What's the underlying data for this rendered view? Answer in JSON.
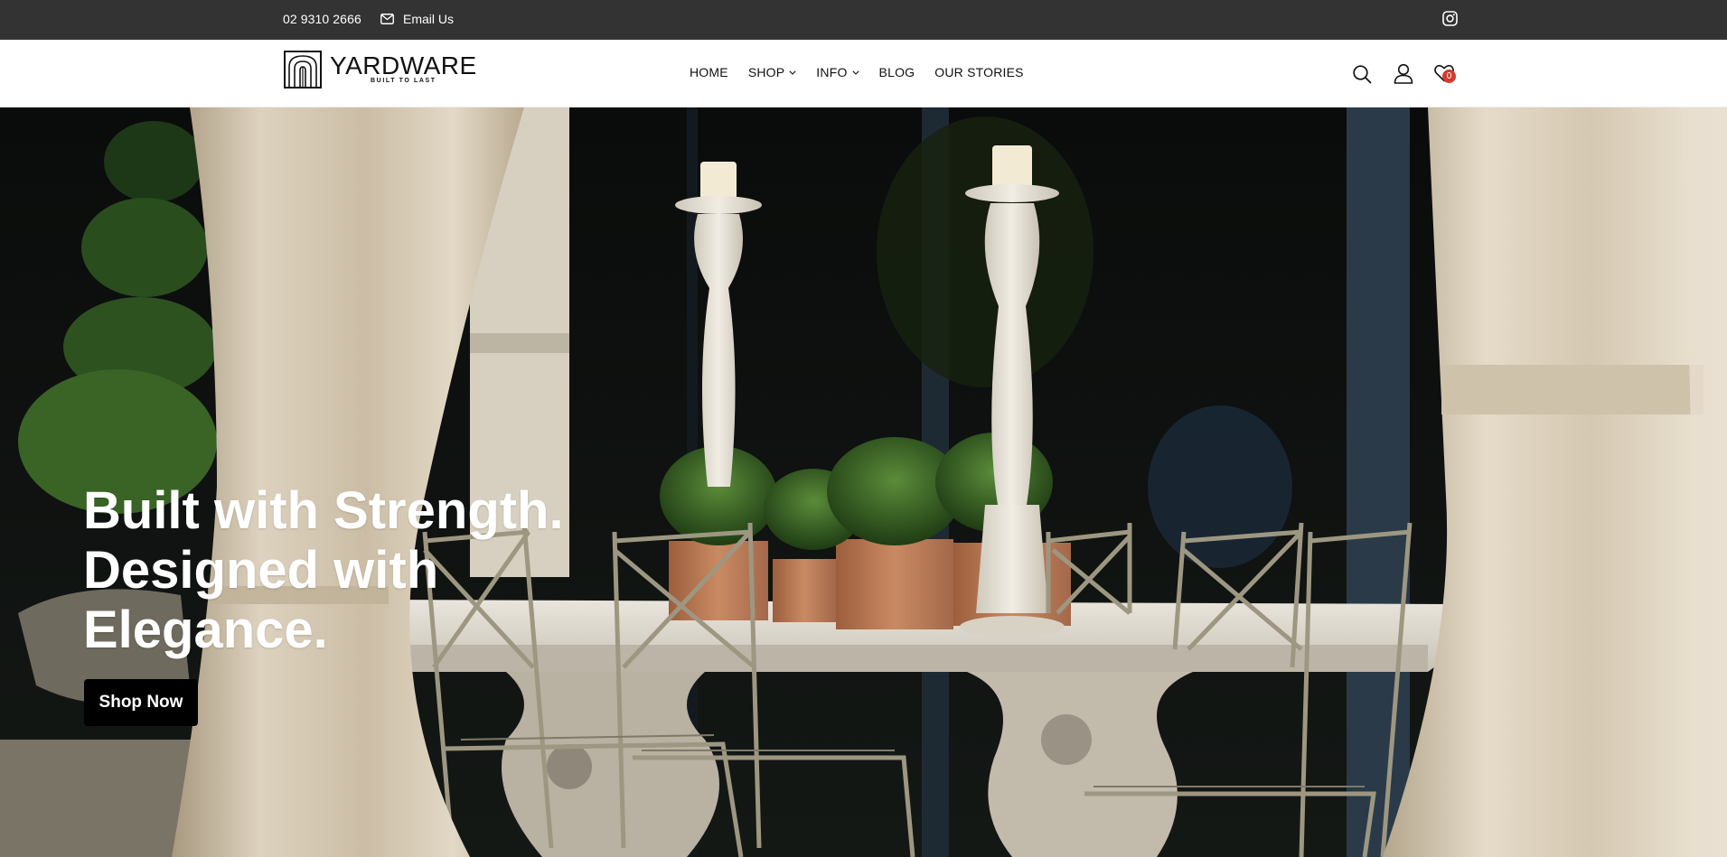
{
  "topbar": {
    "phone": "02 9310 2666",
    "email_label": "Email Us",
    "email_icon": "mail-icon",
    "social_icon": "instagram-icon"
  },
  "header": {
    "logo": {
      "name": "YARDWARE",
      "tagline": "BUILT TO LAST",
      "icon": "yardware-logo-mark"
    },
    "nav": [
      {
        "label": "HOME",
        "has_dropdown": false
      },
      {
        "label": "SHOP",
        "has_dropdown": true
      },
      {
        "label": "INFO",
        "has_dropdown": true
      },
      {
        "label": "BLOG",
        "has_dropdown": false
      },
      {
        "label": "OUR STORIES",
        "has_dropdown": false
      }
    ],
    "icons": [
      "search-icon",
      "account-icon",
      "wishlist-heart-icon"
    ],
    "cart_count": "0"
  },
  "hero": {
    "title_lines": [
      "Built with Strength.",
      "Designed with",
      "Elegance."
    ],
    "cta_label": "Shop Now",
    "image_subject": "outdoor-dining-table-scene"
  },
  "colors": {
    "topbar_bg": "#333333",
    "header_bg": "#ffffff",
    "cta_bg": "#000000",
    "badge_red": "#d23b2f",
    "curtain": "#d9cdb8",
    "stone": "#e6e1d6"
  }
}
